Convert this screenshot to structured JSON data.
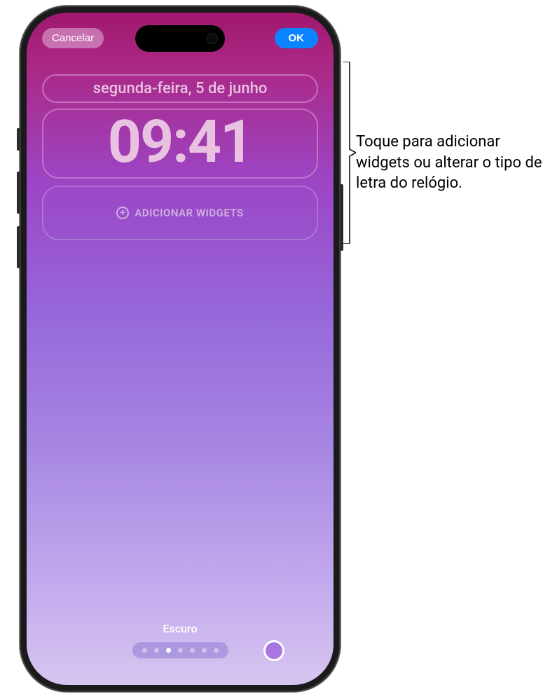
{
  "topBar": {
    "cancelLabel": "Cancelar",
    "okLabel": "OK"
  },
  "lockScreen": {
    "date": "segunda-feira, 5 de junho",
    "time": "09:41",
    "addWidgetsLabel": "ADICIONAR WIDGETS"
  },
  "bottomControls": {
    "styleLabel": "Escuro",
    "pageDots": {
      "total": 7,
      "activeIndex": 2
    },
    "colorSwatch": "#a878e0"
  },
  "callout": {
    "text": "Toque para adicionar widgets ou alterar o tipo de letra do relógio."
  }
}
